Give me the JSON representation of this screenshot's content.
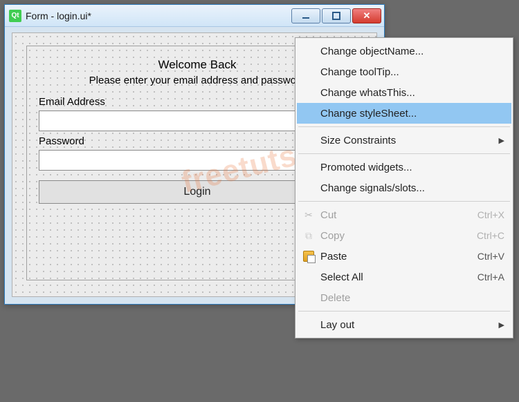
{
  "window": {
    "title": "Form - login.ui*",
    "app_icon_text": "Qt"
  },
  "form": {
    "heading": "Welcome Back",
    "subtitle": "Please enter your email address and password",
    "email_label": "Email Address",
    "email_value": "",
    "password_label": "Password",
    "password_value": "",
    "login_label": "Login"
  },
  "watermark": "freetuts.net",
  "menu": {
    "items": [
      {
        "label": "Change objectName...",
        "type": "item"
      },
      {
        "label": "Change toolTip...",
        "type": "item"
      },
      {
        "label": "Change whatsThis...",
        "type": "item"
      },
      {
        "label": "Change styleSheet...",
        "type": "item",
        "highlight": true
      },
      {
        "type": "sep"
      },
      {
        "label": "Size Constraints",
        "type": "submenu"
      },
      {
        "type": "sep"
      },
      {
        "label": "Promoted widgets...",
        "type": "item"
      },
      {
        "label": "Change signals/slots...",
        "type": "item"
      },
      {
        "type": "sep"
      },
      {
        "label": "Cut",
        "type": "item",
        "shortcut": "Ctrl+X",
        "disabled": true,
        "icon": "cut"
      },
      {
        "label": "Copy",
        "type": "item",
        "shortcut": "Ctrl+C",
        "disabled": true,
        "icon": "copy"
      },
      {
        "label": "Paste",
        "type": "item",
        "shortcut": "Ctrl+V",
        "icon": "paste"
      },
      {
        "label": "Select All",
        "type": "item",
        "shortcut": "Ctrl+A"
      },
      {
        "label": "Delete",
        "type": "item",
        "disabled": true
      },
      {
        "type": "sep"
      },
      {
        "label": "Lay out",
        "type": "submenu"
      }
    ]
  }
}
